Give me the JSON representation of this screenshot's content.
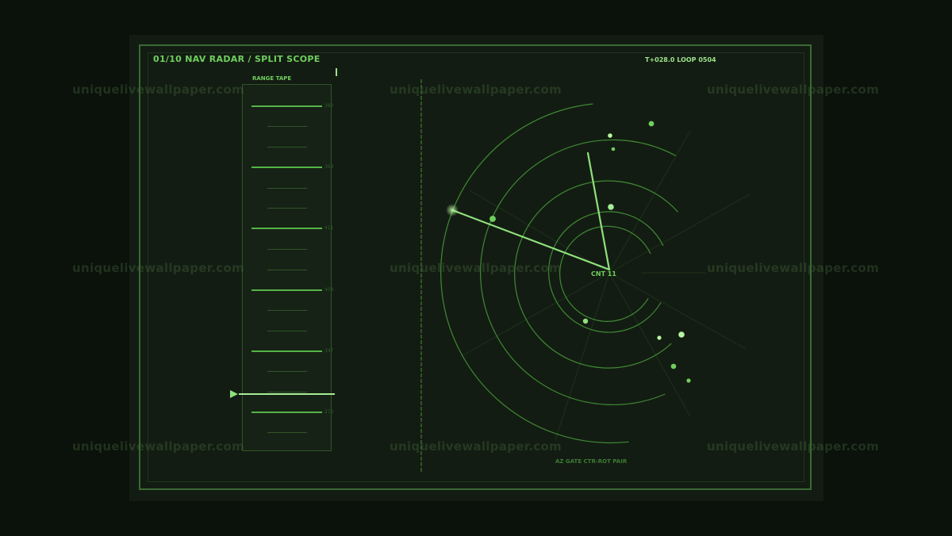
{
  "header": {
    "title": "01/10  NAV RADAR / SPLIT SCOPE",
    "status": "T+028.0  LOOP 0504"
  },
  "tape": {
    "label": "RANGE TAPE",
    "ticks": [
      "382",
      "369",
      "411",
      "408",
      "347",
      "270"
    ]
  },
  "scope": {
    "center_label": "CNT 11",
    "footer_label": "AZ GATE  CTR-ROT PAIR"
  },
  "watermark": {
    "text": "uniquelivewallpaper.com"
  },
  "colors": {
    "accent": "#6fcf5e",
    "bright": "#a8ec96",
    "dim": "#2f5529",
    "background": "#131c12"
  }
}
